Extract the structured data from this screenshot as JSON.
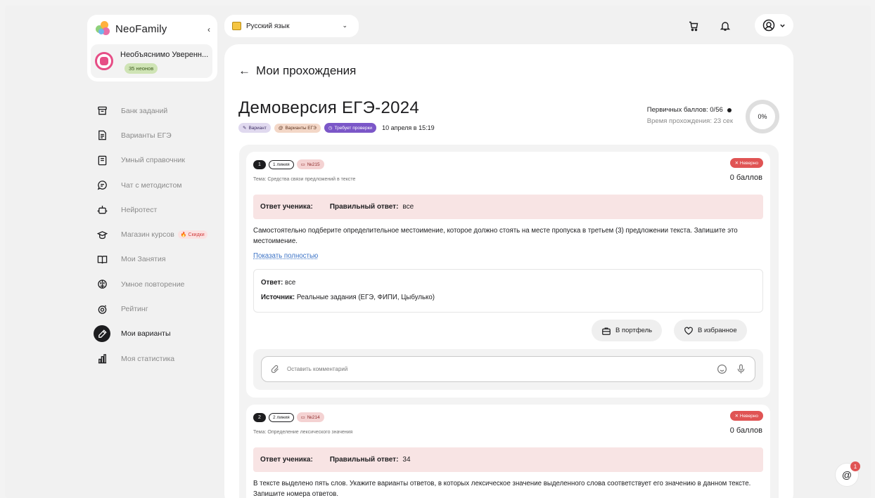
{
  "brand": {
    "name": "NeoFamily",
    "collapse_icon": "‹"
  },
  "user": {
    "name": "Необъяснимо Уверенн...",
    "neons": "35 неонов"
  },
  "nav": [
    {
      "label": "Банк заданий",
      "icon": "archive-icon"
    },
    {
      "label": "Варианты ЕГЭ",
      "icon": "document-icon"
    },
    {
      "label": "Умный справочник",
      "icon": "book-icon"
    },
    {
      "label": "Чат с методистом",
      "icon": "chat-icon"
    },
    {
      "label": "Нейротест",
      "icon": "robot-icon"
    },
    {
      "label": "Магазин курсов",
      "icon": "graduation-cap-icon",
      "badge": "🔥 Скидки"
    },
    {
      "label": "Мои Занятия",
      "icon": "open-book-icon"
    },
    {
      "label": "Умное повторение",
      "icon": "brain-icon"
    },
    {
      "label": "Рейтинг",
      "icon": "rating-icon"
    },
    {
      "label": "Мои варианты",
      "icon": "pencil-icon",
      "active": true
    },
    {
      "label": "Моя статистика",
      "icon": "chart-icon"
    }
  ],
  "subject": {
    "label": "Русский язык"
  },
  "header": {
    "back_label": "Мои прохождения"
  },
  "variant": {
    "title": "Демоверсия ЕГЭ-2024",
    "tags": {
      "variant": "Вариант",
      "ege": "Варианты ЕГЭ",
      "check": "Требует проверки"
    },
    "date": "10 апреля в 15:19",
    "primary_score": "Первичных баллов: 0/56",
    "time": "Время прохождения: 23 сек",
    "progress": "0%"
  },
  "tasks": [
    {
      "num": "1",
      "line": "1 линия",
      "task_no": "№215",
      "topic": "Тема: Средства связи предложений в тексте",
      "status": "Неверно",
      "points": "0 баллов",
      "student_answer_label": "Ответ ученика:",
      "correct_answer_label": "Правильный ответ:",
      "correct_answer": "все",
      "text": "Самостоятельно подберите определительное местоимение, которое должно стоять на месте пропуска в третьем (3) предложении текста. Запишите это местоимение.",
      "show_full": "Показать полностью",
      "answer_label": "Ответ:",
      "answer": "все",
      "source_label": "Источник:",
      "source": "Реальные задания (ЕГЭ, ФИПИ, Цыбулько)",
      "portfolio_btn": "В портфель",
      "favorite_btn": "В избранное",
      "comment_placeholder": "Оставить комментарий"
    },
    {
      "num": "2",
      "line": "2 линия",
      "task_no": "№214",
      "topic": "Тема: Определение лексического значения",
      "status": "Неверно",
      "points": "0 баллов",
      "student_answer_label": "Ответ ученика:",
      "correct_answer_label": "Правильный ответ:",
      "correct_answer": "34",
      "text": "В тексте выделено пять слов. Укажите варианты ответов, в которых лексическое значение выделенного слова соответствует его значению в данном тексте. Запишите номера ответов."
    }
  ],
  "notifications": {
    "count": "1"
  }
}
